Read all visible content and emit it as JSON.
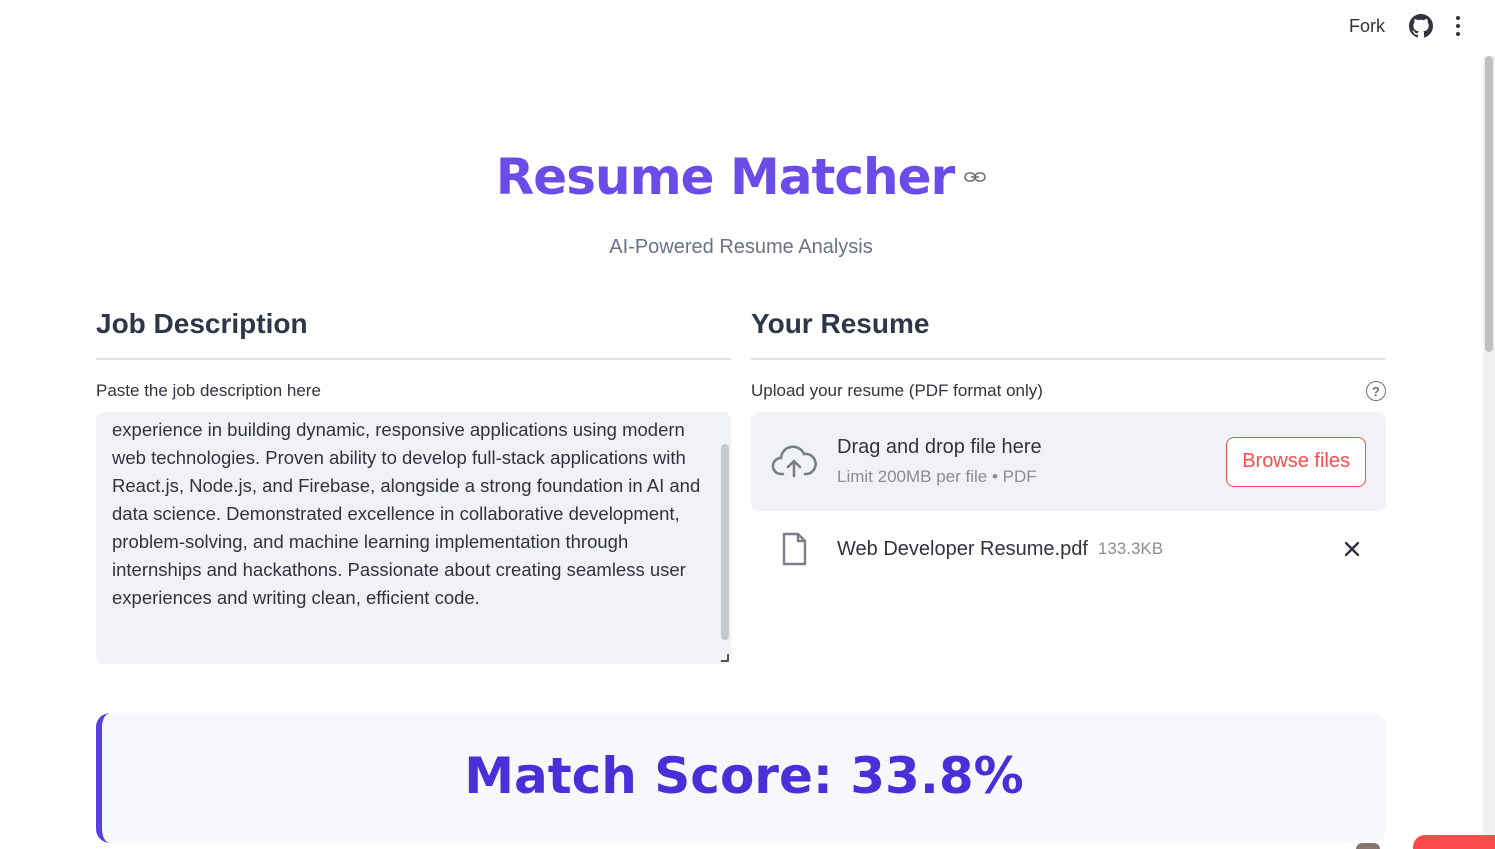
{
  "toolbar": {
    "fork_label": "Fork",
    "github_icon": "github-icon",
    "menu_icon": "kebab-menu-icon"
  },
  "header": {
    "title": "Resume Matcher",
    "subtitle": "AI-Powered Resume Analysis"
  },
  "job_description": {
    "heading": "Job Description",
    "label": "Paste the job description here",
    "value": "experience in building dynamic, responsive applications using modern web technologies. Proven ability to develop full-stack applications with React.js, Node.js, and Firebase, alongside a strong foundation in AI and data science. Demonstrated excellence in collaborative development, problem-solving, and machine learning implementation through internships and hackathons. Passionate about creating seamless user experiences and writing clean, efficient code."
  },
  "resume": {
    "heading": "Your Resume",
    "label": "Upload your resume (PDF format only)",
    "help": "?",
    "dropzone_main": "Drag and drop file here",
    "dropzone_sub": "Limit 200MB per file • PDF",
    "browse_label": "Browse files",
    "file_name": "Web Developer Resume.pdf",
    "file_size": "133.3KB"
  },
  "result": {
    "score_text": "Match Score: 33.8%"
  },
  "colors": {
    "brand": "#6c4ce8",
    "score": "#4a2fd8",
    "accent": "#ff4b4b"
  }
}
